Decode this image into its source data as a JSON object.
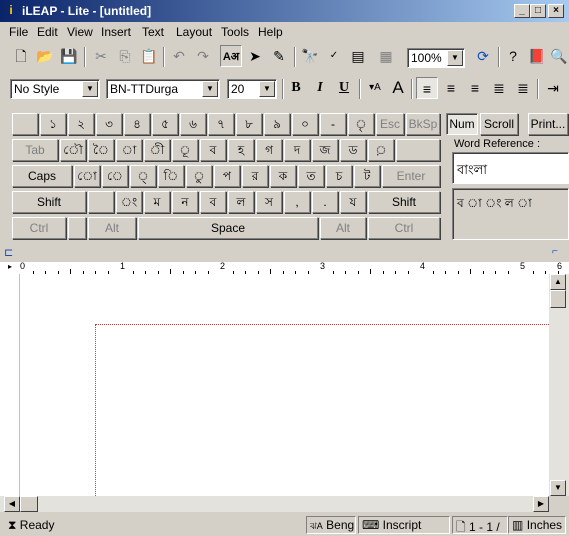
{
  "window": {
    "title": "iLEAP - Lite - [untitled]"
  },
  "menu": [
    "File",
    "Edit",
    "View",
    "Insert",
    "Text",
    "Layout",
    "Tools",
    "Help"
  ],
  "toolbar": {
    "style": "No Style",
    "font": "BN-TTDurga",
    "size": "20",
    "zoom": "100%",
    "bold": "B",
    "italic": "I",
    "underline": "U"
  },
  "keyboard": {
    "row1": [
      "",
      "১",
      "২",
      "৩",
      "৪",
      "৫",
      "৬",
      "৭",
      "৮",
      "৯",
      "০",
      "-",
      "ৃ",
      "Esc",
      "BkSp"
    ],
    "row2": [
      "Tab",
      "ৌ",
      "ৈ",
      "া",
      "ী",
      "ূ",
      "ব",
      "হ",
      "গ",
      "দ",
      "জ",
      "ড",
      "়"
    ],
    "row3": [
      "Caps",
      "ো",
      "ে",
      "্",
      "ি",
      "ু",
      "প",
      "র",
      "ক",
      "ত",
      "চ",
      "ট",
      "Enter"
    ],
    "row4": [
      "Shift",
      "",
      "ং",
      "ম",
      "ন",
      "ব",
      "ল",
      "স",
      ",",
      ".",
      "য",
      "Shift"
    ],
    "row5": [
      "Ctrl",
      "Alt",
      "Space",
      "Alt",
      "Ctrl"
    ],
    "num": "Num",
    "scroll": "Scroll",
    "print": "Print..."
  },
  "word_reference": {
    "label": "Word Reference :",
    "word": "বাংলা",
    "letters": "ব া ং ল া"
  },
  "ruler": [
    "0",
    "1",
    "2",
    "3",
    "4",
    "5",
    "6"
  ],
  "status": {
    "ready": "Ready",
    "language": "Beng",
    "layout": "Inscript",
    "page": "1 - 1 /",
    "units": "Inches"
  }
}
